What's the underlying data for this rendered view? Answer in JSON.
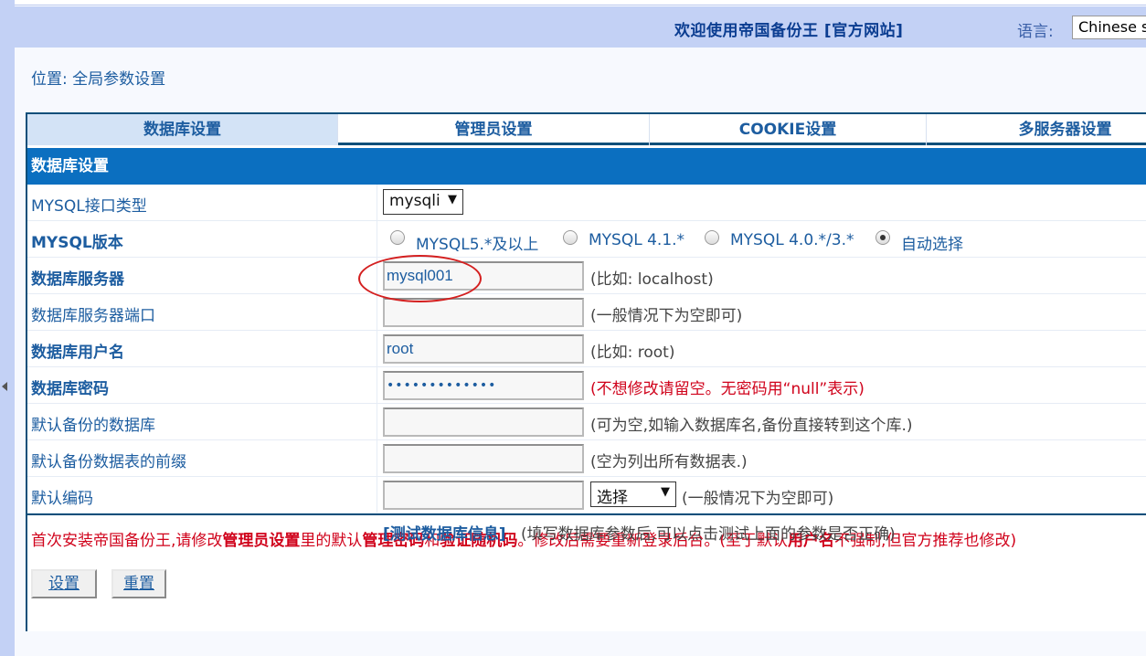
{
  "header": {
    "welcome": "欢迎使用帝国备份王 [官方网站]",
    "language_label": "语言:",
    "language_value": "Chinese s"
  },
  "breadcrumb": "位置: 全局参数设置",
  "tabs": [
    {
      "label": "数据库设置"
    },
    {
      "label": "管理员设置"
    },
    {
      "label": "COOKIE设置"
    },
    {
      "label": "多服务器设置"
    }
  ],
  "section_title": "数据库设置",
  "fields": {
    "mysql_interface": {
      "label": "MYSQL接口类型",
      "value": "mysqli"
    },
    "mysql_version": {
      "label": "MYSQL版本",
      "options": [
        "MYSQL5.*及以上",
        "MYSQL 4.1.*",
        "MYSQL 4.0.*/3.*",
        "自动选择"
      ],
      "selected": "自动选择"
    },
    "db_server": {
      "label": "数据库服务器",
      "value": "mysql001",
      "hint": "(比如: localhost)"
    },
    "db_port": {
      "label": "数据库服务器端口",
      "value": "",
      "hint": "(一般情况下为空即可)"
    },
    "db_user": {
      "label": "数据库用户名",
      "value": "root",
      "hint": "(比如: root)"
    },
    "db_password": {
      "label": "数据库密码",
      "value": "•••••••••••••",
      "hint": "(不想修改请留空。无密码用“null”表示)"
    },
    "default_db": {
      "label": "默认备份的数据库",
      "value": "",
      "hint": "(可为空,如输入数据库名,备份直接转到这个库.)"
    },
    "table_prefix": {
      "label": "默认备份数据表的前缀",
      "value": "",
      "hint": "(空为列出所有数据表.)"
    },
    "charset": {
      "label": "默认编码",
      "value": "",
      "select_value": "选择",
      "hint": "(一般情况下为空即可)"
    }
  },
  "test": {
    "link": "[测试数据库信息]",
    "desc": "(填写数据库参数后,可以点击测试上面的参数是否正确)"
  },
  "notice": {
    "p1": "首次安装帝国备份王,请修改",
    "b1": "管理员设置",
    "p2": "里的默认",
    "b2": "管理密码",
    "p3": "和",
    "b3": "验证随机码",
    "p4": "。修改后需要重新登录后台。(至于默认",
    "b4": "用户名",
    "p5": "不强制,但官方推荐也修改)"
  },
  "buttons": {
    "submit": "设置",
    "reset": "重置"
  }
}
